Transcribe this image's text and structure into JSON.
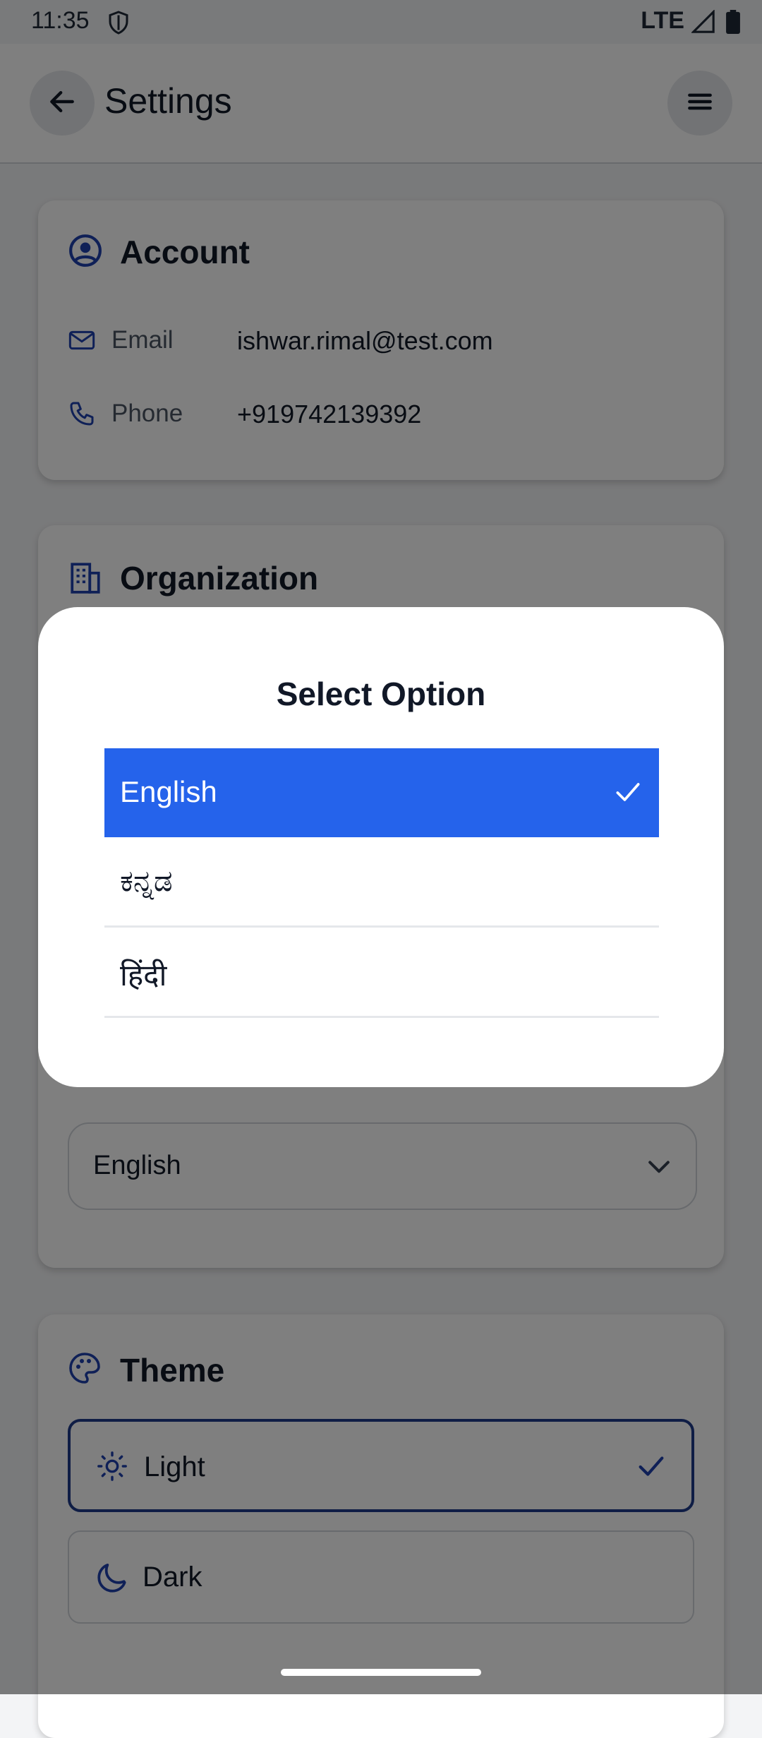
{
  "colors": {
    "accent": "#2563eb",
    "icon_blue": "#1e40af",
    "scrim": "#000000",
    "background": "#f3f4f6"
  },
  "status_bar": {
    "time": "11:35",
    "network": "LTE",
    "icons": [
      "shield-icon",
      "signal-icon",
      "battery-icon"
    ]
  },
  "app_bar": {
    "title": "Settings",
    "icons": [
      "arrow-left-icon",
      "hamburger-menu-icon"
    ]
  },
  "account": {
    "title": "Account",
    "icon": "user-circle-icon",
    "rows": [
      {
        "icon": "mail-icon",
        "label": "Email",
        "value": "ishwar.rimal@test.com"
      },
      {
        "icon": "phone-icon",
        "label": "Phone",
        "value": "+919742139392"
      }
    ]
  },
  "organization": {
    "title": "Organization",
    "icon": "building-icon",
    "language_select": {
      "value": "English",
      "icon": "chevron-down-icon"
    }
  },
  "theme": {
    "title": "Theme",
    "icon": "palette-icon",
    "options": [
      {
        "label": "Light",
        "icon": "sun-icon",
        "selected": true
      },
      {
        "label": "Dark",
        "icon": "moon-icon",
        "selected": false
      }
    ]
  },
  "dialog": {
    "title": "Select Option",
    "options": [
      {
        "label": "English",
        "selected": true
      },
      {
        "label": "ಕನ್ನಡ",
        "selected": false
      },
      {
        "label": "हिंदी",
        "selected": false
      }
    ]
  }
}
